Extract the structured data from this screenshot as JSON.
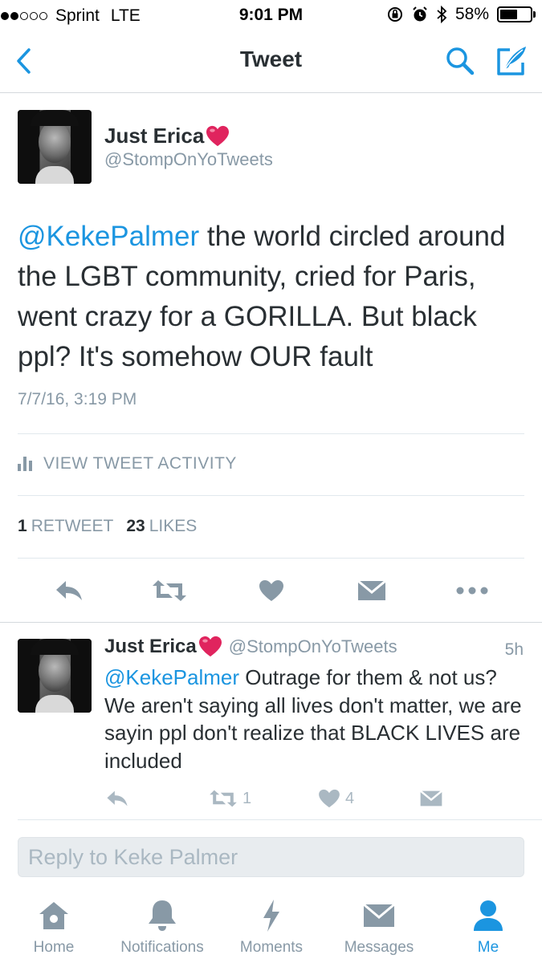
{
  "status_bar": {
    "carrier": "Sprint",
    "network": "LTE",
    "time": "9:01 PM",
    "battery": "58%",
    "battery_level": 0.58,
    "signal_bars_filled": 2,
    "signal_bars_total": 5
  },
  "nav": {
    "title": "Tweet",
    "back_icon": "chevron-left-icon",
    "search_icon": "search-icon",
    "compose_icon": "compose-tweet-icon"
  },
  "main_tweet": {
    "name": "Just Erica",
    "name_emoji": "❤️",
    "handle": "@StompOnYoTweets",
    "mention": "@KekePalmer",
    "text": " the world circled around the LGBT community, cried for Paris, went crazy for a GORILLA. But black ppl? It's somehow OUR fault",
    "timestamp": "7/7/16, 3:19 PM",
    "activity_label": "VIEW TWEET ACTIVITY",
    "retweet_count": "1",
    "retweet_label": "RETWEET",
    "like_count": "23",
    "like_label": "LIKES"
  },
  "reply_tweet": {
    "name": "Just Erica",
    "name_emoji": "❤️",
    "handle": "@StompOnYoTweets",
    "time": "5h",
    "mention": "@KekePalmer",
    "text": " Outrage for them & not us? We aren't saying all lives don't matter, we are sayin ppl don't realize that BLACK LIVES are included",
    "retweet_count": "1",
    "like_count": "4"
  },
  "reply_box": {
    "placeholder": "Reply to Keke Palmer"
  },
  "tabs": [
    {
      "label": "Home",
      "icon": "home-icon",
      "active": false
    },
    {
      "label": "Notifications",
      "icon": "bell-icon",
      "active": false
    },
    {
      "label": "Moments",
      "icon": "lightning-icon",
      "active": false
    },
    {
      "label": "Messages",
      "icon": "envelope-icon",
      "active": false
    },
    {
      "label": "Me",
      "icon": "person-icon",
      "active": true
    }
  ],
  "colors": {
    "accent": "#1b95e0",
    "text_primary": "#292f33",
    "text_secondary": "#8899a6",
    "icon_muted": "#aab8c2",
    "heart": "#e0245e"
  }
}
